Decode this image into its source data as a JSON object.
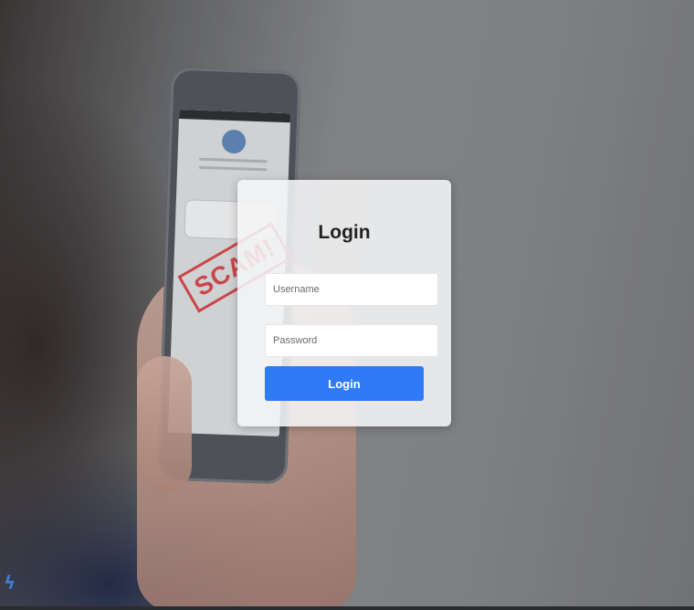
{
  "background": {
    "stamp_text": "SCAM!",
    "corner_logo_icon": "lightning-bolt-icon"
  },
  "login": {
    "title": "Login",
    "username_placeholder": "Username",
    "username_value": "",
    "password_placeholder": "Password",
    "password_value": "",
    "button_label": "Login"
  },
  "colors": {
    "button_bg": "#2f7bf7",
    "card_bg": "#f5f5f6",
    "stamp": "#c9383c"
  }
}
